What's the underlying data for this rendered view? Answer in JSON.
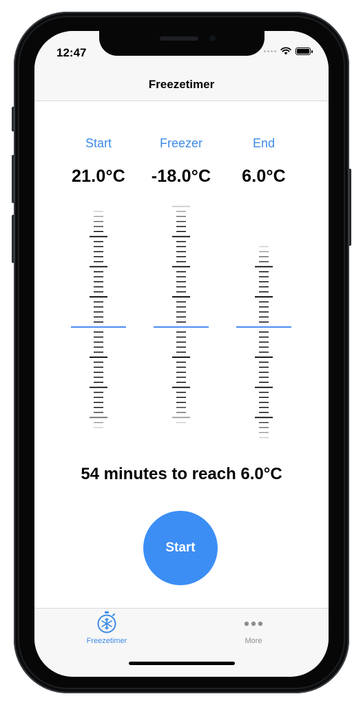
{
  "status": {
    "time": "12:47"
  },
  "nav": {
    "title": "Freezetimer"
  },
  "columns": [
    {
      "label": "Start",
      "value": "21.0°C"
    },
    {
      "label": "Freezer",
      "value": "-18.0°C"
    },
    {
      "label": "End",
      "value": "6.0°C"
    }
  ],
  "result": {
    "text": "54 minutes to reach 6.0°C"
  },
  "start_button": {
    "label": "Start"
  },
  "tabs": [
    {
      "label": "Freezetimer",
      "icon": "snowflake-stopwatch-icon",
      "selected": true
    },
    {
      "label": "More",
      "icon": "more-dots-icon",
      "selected": false
    }
  ],
  "colors": {
    "accent": "#3d8be8",
    "button": "#3c8ef5",
    "indicator": "#4a8df0"
  }
}
